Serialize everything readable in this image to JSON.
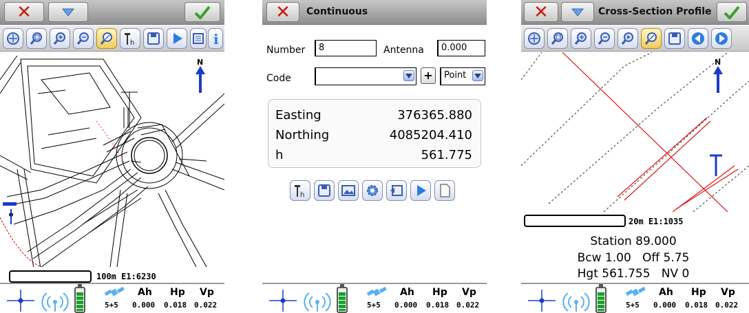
{
  "icons": {
    "close": "close-icon",
    "dropdown": "chevron-down-icon",
    "ok": "check-icon",
    "zoom_all": "zoom-all-icon",
    "zoom_window": "zoom-window-icon",
    "zoom_in": "zoom-in-icon",
    "zoom_out": "zoom-out-icon",
    "zoom_pan": "pan-icon",
    "antenna_height": "antenna-height-icon",
    "save": "save-icon",
    "play": "play-icon",
    "info": "info-icon",
    "north": "north-arrow-icon"
  },
  "panels": {
    "map": {
      "scale_label": "100m E1:6230",
      "north_label": "N"
    },
    "continuous": {
      "title": "Continuous",
      "number_label": "Number",
      "number_value": "8",
      "antenna_label": "Antenna",
      "antenna_value": "0.000",
      "code_label": "Code",
      "code_value": "",
      "add_label": "+",
      "point_type": "Point",
      "coords": [
        {
          "label": "Easting",
          "value": "376365.880"
        },
        {
          "label": "Northing",
          "value": "4085204.410"
        },
        {
          "label": "h",
          "value": "561.775"
        }
      ]
    },
    "cross_section": {
      "title": "Cross-Section Profile",
      "scale_label": "20m E1:1035",
      "north_label": "N",
      "station": "Station 89.000",
      "bcw_off": "Bcw 1.00   Off 5.75",
      "hgt_nv": "Hgt 561.755   NV 0"
    }
  },
  "status": {
    "sats": "5+5",
    "ah_label": "Ah",
    "hp_label": "Hp",
    "vp_label": "Vp",
    "ah_value": "0.000",
    "hp_value": "0.018",
    "vp_value": "0.022",
    "battery_level": 0.8
  },
  "colors": {
    "close_red": "#c81e10",
    "ok_green": "#3aa02a",
    "north_blue": "#1a3cc8",
    "profile_red": "#e01010",
    "gps_blue": "#1e3cc8"
  }
}
